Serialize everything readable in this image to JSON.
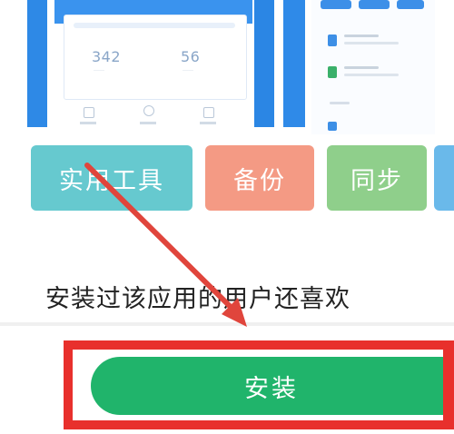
{
  "screenshots": {
    "stats": [
      {
        "value": "342",
        "label": "……"
      },
      {
        "value": "56",
        "label": "……"
      }
    ]
  },
  "categories": [
    {
      "label": "实用工具",
      "color": "#66c9cf"
    },
    {
      "label": "备份",
      "color": "#f49a84"
    },
    {
      "label": "同步",
      "color": "#8fcf8b"
    }
  ],
  "section": {
    "title": "安装过该应用的用户还喜欢"
  },
  "install": {
    "label": "安装",
    "button_color": "#20b46b",
    "highlight_color": "#e8302c"
  },
  "annotation": {
    "arrow_icon": "red-arrow-icon",
    "arrow_color": "#e0453c"
  }
}
